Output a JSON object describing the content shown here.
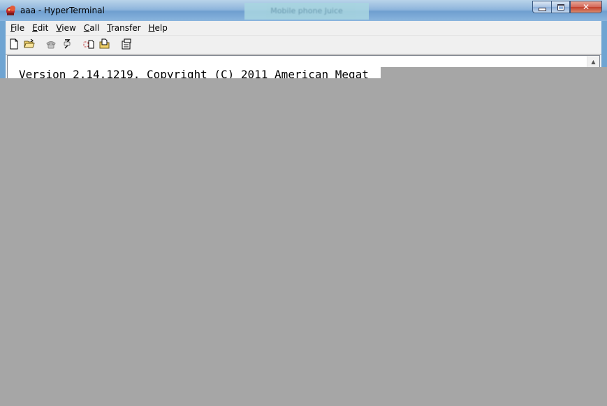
{
  "window": {
    "title": "aaa - HyperTerminal",
    "background_title_blur": "Mobile phone Juice"
  },
  "menu": {
    "items": [
      {
        "label": "File",
        "mnemonic": "F",
        "rest": "ile"
      },
      {
        "label": "Edit",
        "mnemonic": "E",
        "rest": "dit"
      },
      {
        "label": "View",
        "mnemonic": "V",
        "rest": "iew"
      },
      {
        "label": "Call",
        "mnemonic": "C",
        "rest": "all"
      },
      {
        "label": "Transfer",
        "mnemonic": "T",
        "rest": "ransfer"
      },
      {
        "label": "Help",
        "mnemonic": "H",
        "rest": "elp"
      }
    ]
  },
  "toolbar": {
    "buttons": [
      {
        "icon": "new-document-icon"
      },
      {
        "icon": "open-folder-icon"
      },
      {
        "icon": "phone-connect-icon"
      },
      {
        "icon": "phone-disconnect-icon"
      },
      {
        "icon": "send-file-icon"
      },
      {
        "icon": "receive-file-icon"
      },
      {
        "icon": "properties-icon"
      }
    ]
  },
  "terminal": {
    "line1": "Version 2.14.1219. Copyright (C) 2011 American Megat"
  },
  "colors": {
    "titlebar": "#8fb6dc",
    "close_button": "#c3402c",
    "redaction": "#a6a6a6"
  }
}
